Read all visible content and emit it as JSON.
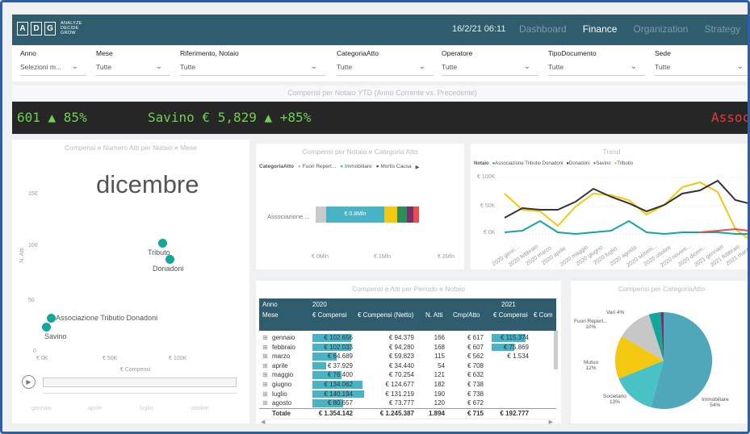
{
  "header": {
    "logo_letters": [
      "A",
      "D",
      "G"
    ],
    "logo_tag": [
      "ANALYZE",
      "DECIDE",
      "GROW"
    ],
    "datetime": "16/2/21 06:11",
    "nav": [
      "Dashboard",
      "Finance",
      "Organization",
      "Strategy"
    ],
    "active_nav": "Finance"
  },
  "filters": [
    {
      "label": "Anno",
      "value": "Selezioni m..."
    },
    {
      "label": "Mese",
      "value": "Tutte"
    },
    {
      "label": "Riferimento, Notaio",
      "value": "Tutte"
    },
    {
      "label": "CategoriaAtto",
      "value": "Tutte"
    },
    {
      "label": "Operatore",
      "value": "Tutte"
    },
    {
      "label": "TipoDocumento",
      "value": "Tutte"
    },
    {
      "label": "Sede",
      "value": "Tutte"
    }
  ],
  "banner": {
    "title": "Compensi per Notaio YTD (Anno Corrente vs. Precedente)"
  },
  "ticker": {
    "item1": "601 ▲ 85%",
    "item2": "Savino € 5,829 ▲ +85%",
    "item3": "Assoc"
  },
  "scatter": {
    "title": "Compensi e Numero Atti per Notaio e Mese",
    "month": "dicembre",
    "ylabel": "N. Atti",
    "xlabel": "€ Compensi",
    "y_ticks": [
      "150",
      "100",
      "50",
      "0"
    ],
    "x_ticks": [
      "€ 0K",
      "€ 50K",
      "€ 100K"
    ],
    "points": [
      {
        "label": "Tributo"
      },
      {
        "label": "Donadoni"
      },
      {
        "label": "Associazione Tributio Donadoni"
      },
      {
        "label": "Savino"
      }
    ],
    "play_icon": "play-icon",
    "timeline": [
      "gennaio",
      "aprile",
      "luglio",
      "ottobre"
    ]
  },
  "stacked": {
    "title": "Compensi per Notaio e Categoria Atto",
    "legend_title": "CategoriaAtto",
    "legend": [
      "Fuori Repert...",
      "Immobiliare",
      "Mortis Causa"
    ],
    "category": "Associazione ...",
    "bar_label": "€ 0.8Mln",
    "x_ticks": [
      "€ 0Mln",
      "€ 1Mln",
      "€ 2Mln"
    ]
  },
  "trend": {
    "title": "Trend",
    "legend_title": "Notaio",
    "legend": [
      "Associazione Tributio Donadoni",
      "Donadoni",
      "Savino",
      "Tributio"
    ],
    "y_ticks": [
      "€ 100K",
      "€ 50K",
      "€ 0K"
    ],
    "x_ticks": [
      "2020 genn...",
      "2020 febbraio",
      "2020 marzo",
      "2020 aprile",
      "2020 maggio",
      "2020 giugno",
      "2020 luglio",
      "2020 agosto",
      "2020 settem...",
      "2020 ottobre",
      "2020 novem...",
      "2020 dicem...",
      "2021 gennaio",
      "2021 febbraio",
      "2021 marzo"
    ],
    "colors": {
      "Associazione Tributio Donadoni": "#13a69a",
      "Donadoni": "#333333",
      "Savino": "#e84c4c",
      "Tributio": "#f2c811"
    }
  },
  "table": {
    "title": "Compensi e Atti per Periodo e Notaio",
    "h1": [
      "Anno",
      "2020",
      "2021"
    ],
    "h2": [
      "Mese",
      "€ Compensi",
      "€ Compensi (Netto)",
      "N. Atti",
      "Cmp/Atto",
      "€ Compensi",
      "€ Com"
    ],
    "rows": [
      {
        "mese": "gennaio",
        "comp": "€ 102.656",
        "netto": "€ 94.379",
        "atti": "166",
        "cmp": "€ 617",
        "comp21": "€ 115.374"
      },
      {
        "mese": "febbraio",
        "comp": "€ 102.033",
        "netto": "€ 94.280",
        "atti": "168",
        "cmp": "€ 607",
        "comp21": "€ 75.869"
      },
      {
        "mese": "marzo",
        "comp": "€ 64.689",
        "netto": "€ 59.823",
        "atti": "115",
        "cmp": "€ 562",
        "comp21": "€ 1.534"
      },
      {
        "mese": "aprile",
        "comp": "€ 37.929",
        "netto": "€ 34.440",
        "atti": "54",
        "cmp": "€ 708",
        "comp21": ""
      },
      {
        "mese": "maggio",
        "comp": "€ 76.400",
        "netto": "€ 70.254",
        "atti": "121",
        "cmp": "€ 632",
        "comp21": ""
      },
      {
        "mese": "giugno",
        "comp": "€ 134.062",
        "netto": "€ 124.677",
        "atti": "182",
        "cmp": "€ 738",
        "comp21": ""
      },
      {
        "mese": "luglio",
        "comp": "€ 140.194",
        "netto": "€ 131.219",
        "atti": "190",
        "cmp": "€ 738",
        "comp21": ""
      },
      {
        "mese": "agosto",
        "comp": "€ 80.657",
        "netto": "€ 73.777",
        "atti": "120",
        "cmp": "€ 672",
        "comp21": ""
      }
    ],
    "total": {
      "label": "Totale",
      "comp": "€ 1.354.142",
      "netto": "€ 1.245.387",
      "atti": "1.894",
      "cmp": "€ 715",
      "comp21": "€ 192.777"
    }
  },
  "pie": {
    "title": "Compensi per CategoriaAtto",
    "labels": [
      {
        "name": "Vari",
        "pct": "4%"
      },
      {
        "name": "Fuori Repert...",
        "pct": "10%"
      },
      {
        "name": "Mutuo",
        "pct": "12%"
      },
      {
        "name": "Societario",
        "pct": "13%"
      },
      {
        "name": "Immobiliare",
        "pct": "54%"
      }
    ]
  }
}
